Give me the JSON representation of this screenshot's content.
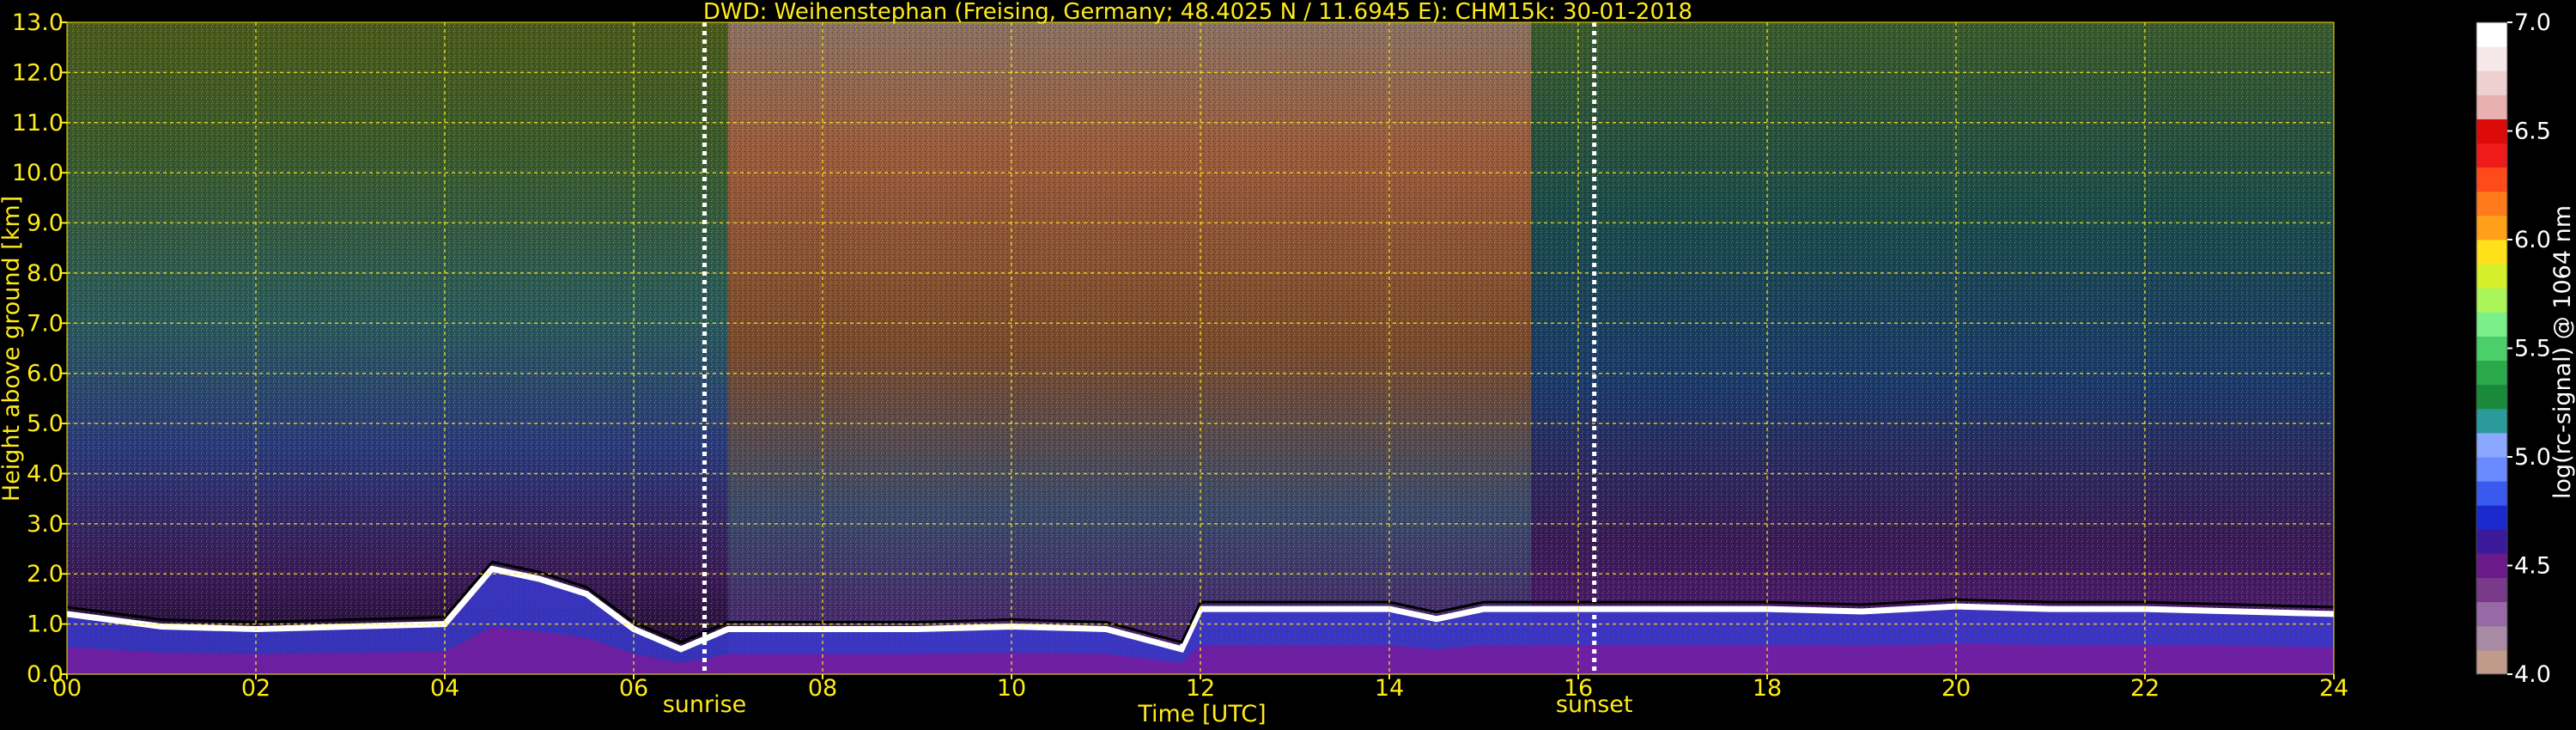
{
  "chart_data": {
    "type": "heatmap",
    "title": "DWD: Weihenstephan (Freising, Germany; 48.4025 N / 11.6945 E):    CHM15k: 30-01-2018",
    "xlabel": "Time [UTC]",
    "ylabel": "Height above ground [km]",
    "xlim": [
      0,
      24
    ],
    "ylim": [
      0,
      13
    ],
    "x_ticks": [
      0,
      2,
      4,
      6,
      8,
      10,
      12,
      14,
      16,
      18,
      20,
      22,
      24
    ],
    "x_tick_labels": [
      "00",
      "02",
      "04",
      "06",
      "08",
      "10",
      "12",
      "14",
      "16",
      "18",
      "20",
      "22",
      "24"
    ],
    "y_ticks": [
      0,
      1,
      2,
      3,
      4,
      5,
      6,
      7,
      8,
      9,
      10,
      11,
      12,
      13
    ],
    "y_tick_labels": [
      "0.0",
      "1.0",
      "2.0",
      "3.0",
      "4.0",
      "5.0",
      "6.0",
      "7.0",
      "8.0",
      "9.0",
      "10.0",
      "11.0",
      "12.0",
      "13.0"
    ],
    "grid": true,
    "events": [
      {
        "label": "sunrise",
        "x": 6.75
      },
      {
        "label": "sunset",
        "x": 16.17
      }
    ],
    "cloud_base_height_km": {
      "x": [
        0,
        1,
        2,
        3,
        4,
        4.5,
        5,
        5.5,
        6,
        6.5,
        7,
        8,
        9,
        10,
        11,
        11.8,
        12,
        13,
        14,
        14.5,
        15,
        16,
        17,
        18,
        19,
        20,
        21,
        22,
        23,
        24
      ],
      "y": [
        1.2,
        0.95,
        0.9,
        0.95,
        1.0,
        2.1,
        1.9,
        1.6,
        0.9,
        0.5,
        0.9,
        0.9,
        0.9,
        0.95,
        0.9,
        0.5,
        1.3,
        1.3,
        1.3,
        1.1,
        1.3,
        1.3,
        1.3,
        1.3,
        1.25,
        1.35,
        1.3,
        1.3,
        1.25,
        1.2
      ]
    },
    "colorbar": {
      "label": "log(rc-signal) @ 1064 nm",
      "range": [
        4.0,
        7.0
      ],
      "ticks": [
        "4.0",
        "4.5",
        "5.0",
        "5.5",
        "6.0",
        "6.5",
        "7.0"
      ],
      "colors": [
        "#c09a8a",
        "#a88aa5",
        "#986aa5",
        "#7a3a8a",
        "#6a1a8a",
        "#3a1a9a",
        "#1a2acf",
        "#3a5aef",
        "#6a8aff",
        "#8aa8ff",
        "#2a9a9a",
        "#1a8a3a",
        "#2aaa4a",
        "#4acf6a",
        "#7aef8a",
        "#aaf55a",
        "#d5ef2a",
        "#ffe01a",
        "#ffa01a",
        "#ff7a1a",
        "#ff4a1a",
        "#ef1a1a",
        "#dd0a0a",
        "#e8b0b0",
        "#efd0d0",
        "#f5e8e8",
        "#ffffff"
      ]
    }
  }
}
